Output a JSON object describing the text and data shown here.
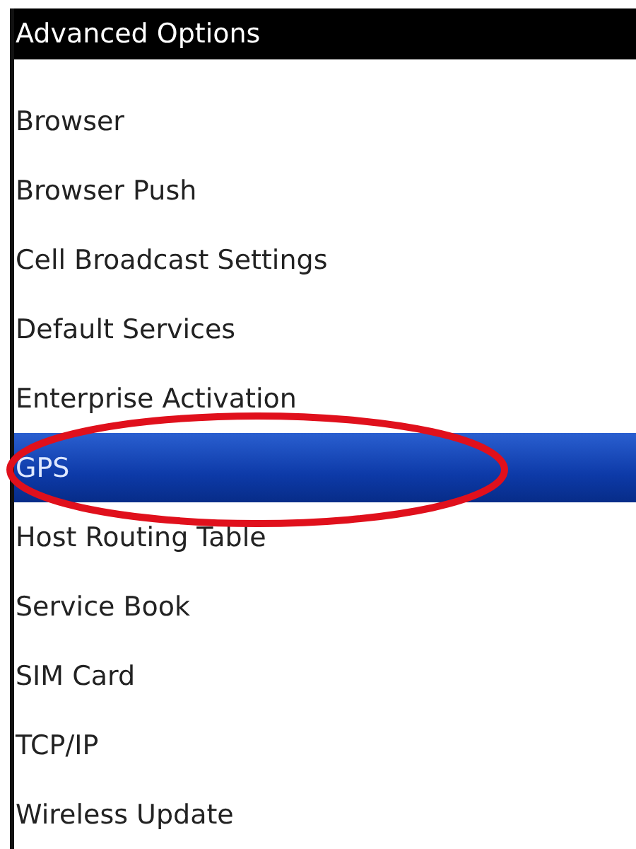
{
  "header": {
    "title": "Advanced Options"
  },
  "items": [
    {
      "label": "Browser",
      "selected": false
    },
    {
      "label": "Browser Push",
      "selected": false
    },
    {
      "label": "Cell Broadcast Settings",
      "selected": false
    },
    {
      "label": "Default Services",
      "selected": false
    },
    {
      "label": "Enterprise Activation",
      "selected": false
    },
    {
      "label": "GPS",
      "selected": true
    },
    {
      "label": "Host Routing Table",
      "selected": false
    },
    {
      "label": "Service Book",
      "selected": false
    },
    {
      "label": "SIM Card",
      "selected": false
    },
    {
      "label": "TCP/IP",
      "selected": false
    },
    {
      "label": "Wireless Update",
      "selected": false
    }
  ],
  "annotation": {
    "kind": "ellipse",
    "color": "#e0101c"
  }
}
